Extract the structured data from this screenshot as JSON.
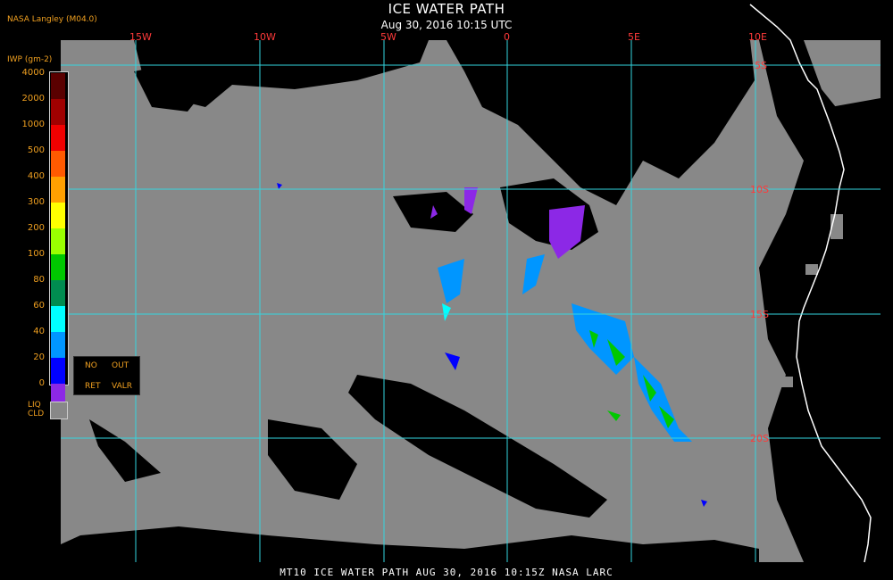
{
  "header": {
    "title": "ICE WATER PATH",
    "subtitle": "Aug 30, 2016 10:15 UTC",
    "producer": "NASA Langley (M04.0)"
  },
  "map": {
    "longitude_labels": [
      "15W",
      "10W",
      "5W",
      "0",
      "5E",
      "10E"
    ],
    "latitude_labels": [
      "5S",
      "10S",
      "15S",
      "20S"
    ],
    "colors": {
      "clear_sky": "#000000",
      "liquid_cloud": "#888888",
      "grid": "#33d6e0",
      "coastline": "#ffffff",
      "grid_label": "#ff3a3a"
    }
  },
  "legend": {
    "unit_label": "IWP (gm-2)",
    "ticks": [
      "4000",
      "2000",
      "1000",
      "500",
      "400",
      "300",
      "200",
      "100",
      "80",
      "60",
      "40",
      "20",
      "0"
    ],
    "colors": [
      "#5a0000",
      "#a00000",
      "#f00000",
      "#ff5a00",
      "#ffa000",
      "#ffff00",
      "#9aff00",
      "#00c800",
      "#008c50",
      "#00ffff",
      "#0096ff",
      "#0000ff",
      "#8c28e6"
    ],
    "no_data": {
      "no": "NO",
      "out": "OUT",
      "ret": "RET",
      "valr": "VALR"
    },
    "liquid_cloud": {
      "liq": "LIQ",
      "cld": "CLD"
    }
  },
  "footer": {
    "caption": "MT10  ICE WATER PATH  AUG 30, 2016 10:15Z  NASA LARC"
  }
}
